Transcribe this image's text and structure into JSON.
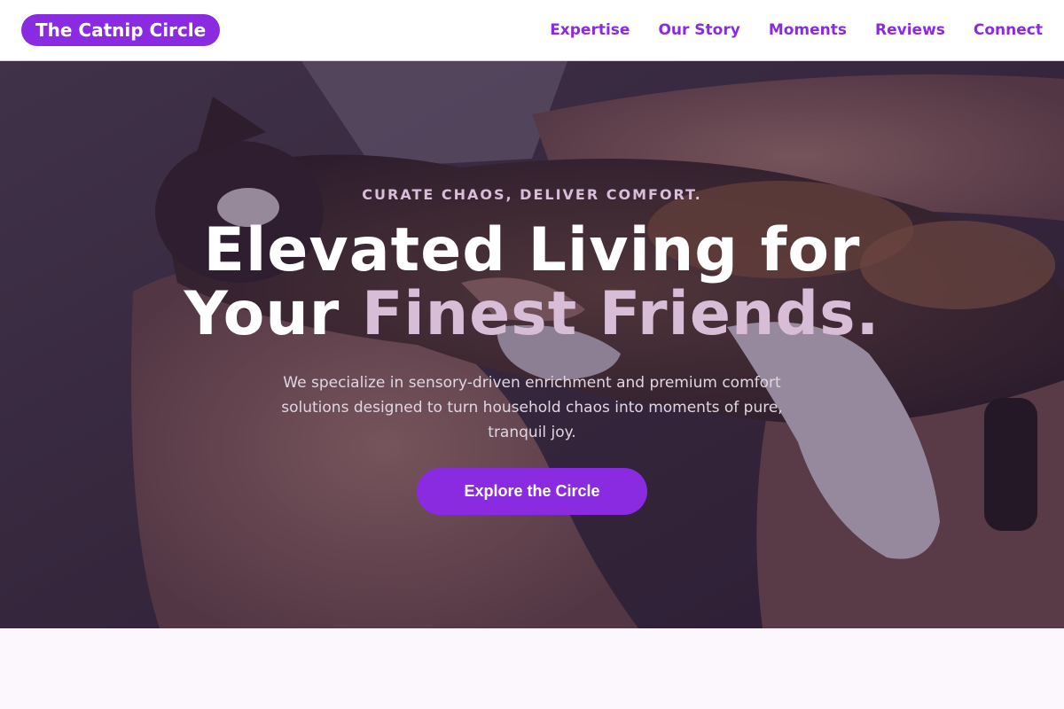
{
  "nav": {
    "brand": "The Catnip Circle",
    "links": [
      "Expertise",
      "Our Story",
      "Moments",
      "Reviews",
      "Connect"
    ]
  },
  "hero": {
    "eyebrow": "CURATE CHAOS, DELIVER COMFORT.",
    "headline_line1": "Elevated Living for",
    "headline_line2_prefix": "Your ",
    "headline_line2_accent": "Finest Friends.",
    "subtext": "We specialize in sensory-driven enrichment and premium comfort solutions designed to turn household chaos into moments of pure, tranquil joy.",
    "cta_label": "Explore the Circle",
    "background_image": "cat-being-petted-photo"
  },
  "colors": {
    "accent": "#8a2be2",
    "headline_accent": "#d8bdd7",
    "page_background": "#fcf7fd"
  }
}
